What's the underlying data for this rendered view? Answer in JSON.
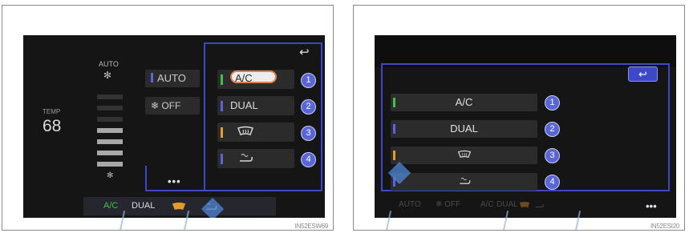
{
  "left": {
    "temp_label": "TEMP",
    "temp_value": "68",
    "fan_mode": "AUTO",
    "buttons": {
      "auto": "AUTO",
      "off": "❄ OFF"
    },
    "options": [
      "A/C",
      "DUAL",
      "",
      ""
    ],
    "more": "•••",
    "status": [
      "A/C",
      "DUAL"
    ],
    "code": "IN52ESW69"
  },
  "right": {
    "options": [
      "A/C",
      "DUAL",
      "",
      ""
    ],
    "more": "•••",
    "status": [
      "AUTO",
      "❄ OFF",
      "A/C",
      "DUAL"
    ],
    "code": "IN52ESI20"
  },
  "numbers": [
    "1",
    "2",
    "3",
    "4"
  ],
  "back_icon": "↩",
  "colors": {
    "accent_blue": "#3d48c8",
    "badge_blue": "#5a66d6",
    "selected_outline": "#e07d4d",
    "indicator_green": "#3cc24a",
    "indicator_blue": "#5b63e0",
    "indicator_orange": "#e59a2a"
  },
  "icons": [
    "fan-icon",
    "windshield-defrost-icon",
    "recirculation-icon",
    "back-arrow-icon"
  ]
}
